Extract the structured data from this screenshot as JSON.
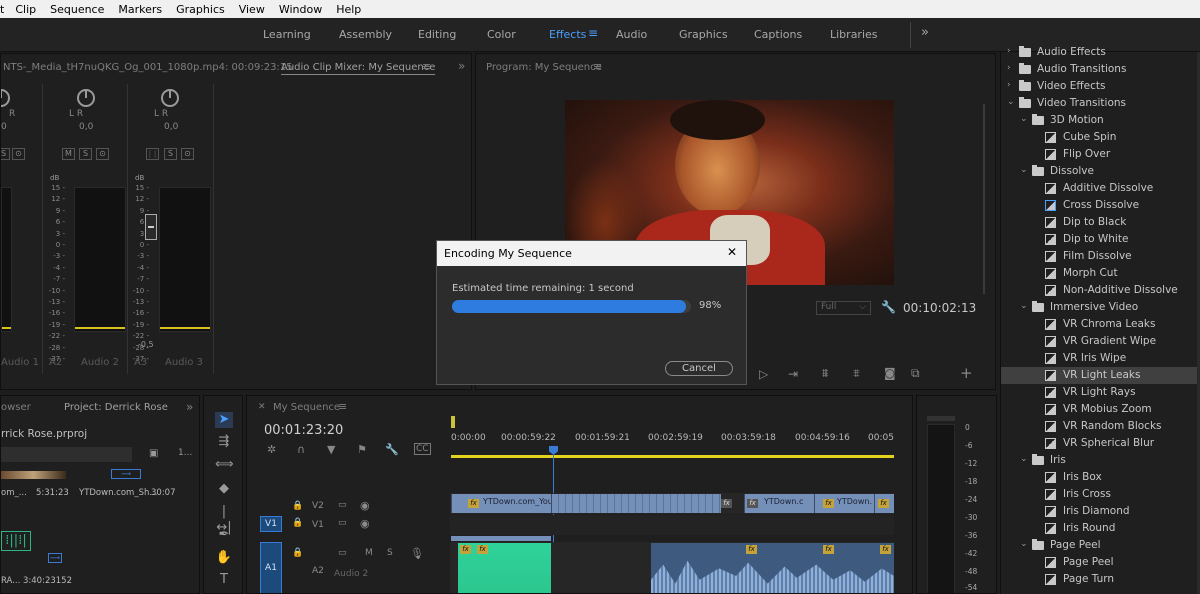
{
  "menu": [
    "t",
    "Clip",
    "Sequence",
    "Markers",
    "Graphics",
    "View",
    "Window",
    "Help"
  ],
  "workspaces": {
    "tabs": [
      "Learning",
      "Assembly",
      "Editing",
      "Color",
      "Effects",
      "Audio",
      "Graphics",
      "Captions",
      "Libraries"
    ],
    "active": "Effects",
    "overflow": "»"
  },
  "source_panel": {
    "clip_name": "NTS-_Media_tH7nuQKG_Og_001_1080p.mp4: 00:09:23:15",
    "tab": "Audio Clip Mixer: My Sequence",
    "channels": [
      {
        "lr": "L  R",
        "value": "0,0",
        "label": "Audio 1",
        "track": "A1"
      },
      {
        "lr": "L  R",
        "value": "0,0",
        "label": "Audio 2",
        "track": "A2"
      },
      {
        "lr": "L  R",
        "value": "0,0",
        "label": "Audio 3",
        "track": "A3"
      }
    ],
    "db_label": "dB",
    "db_scale": [
      "15 -",
      "12 -",
      "9 -",
      "6 -",
      "3 -",
      "0 -",
      "-3 -",
      "-4 -",
      "-7 -",
      "-10 -",
      "-13 -",
      "-16 -",
      "-19 -",
      "-22 -",
      "-28 -",
      "-37 -"
    ],
    "fader_value": "-0,5",
    "msr": [
      "M",
      "S",
      "R"
    ]
  },
  "program_monitor": {
    "title": "Program: My Sequence",
    "timecode": "00:10:02:13",
    "fit": "Full"
  },
  "dialog": {
    "title": "Encoding My Sequence",
    "status": "Estimated time remaining: 1 second",
    "progress": 98,
    "progress_text": "98%",
    "cancel": "Cancel",
    "close": "✕"
  },
  "project_panel": {
    "tabs": [
      "owser",
      "Project: Derrick Rose"
    ],
    "project_file": "rrick Rose.prproj",
    "page": "1...",
    "items": [
      {
        "name": "om_...",
        "duration": "5:31:23"
      },
      {
        "name": "YTDown.com_Sh...",
        "duration": "30:07"
      },
      {
        "name": "RA...",
        "duration": "3:40:23152"
      }
    ]
  },
  "timeline": {
    "tab": "My Sequence",
    "timecode": "00:01:23:20",
    "ruler": [
      "0:00:00",
      "00:00:59:22",
      "00:01:59:21",
      "00:02:59:19",
      "00:03:59:18",
      "00:04:59:16",
      "00:05"
    ],
    "tracks": [
      {
        "id": "V2",
        "patch": ""
      },
      {
        "id": "V1",
        "patch": "V1"
      },
      {
        "id": "A2",
        "patch": "A1",
        "name": "Audio 2"
      }
    ],
    "clips_v2": [
      "YTDown.com_You",
      "YTDown.c",
      "YTDown."
    ],
    "fx": "fx"
  },
  "audio_meter_scale": [
    "0",
    "-6",
    "-12",
    "-18",
    "-24",
    "-30",
    "-36",
    "-42",
    "-48",
    "-54"
  ],
  "effects_panel": {
    "rows": [
      {
        "level": 0,
        "type": "folder",
        "label": "Audio Effects",
        "expanded": false
      },
      {
        "level": 0,
        "type": "folder",
        "label": "Audio Transitions",
        "expanded": false
      },
      {
        "level": 0,
        "type": "folder",
        "label": "Video Effects",
        "expanded": false
      },
      {
        "level": 0,
        "type": "folder",
        "label": "Video Transitions",
        "expanded": true
      },
      {
        "level": 1,
        "type": "folder",
        "label": "3D Motion",
        "expanded": true
      },
      {
        "level": 2,
        "type": "fx",
        "label": "Cube Spin"
      },
      {
        "level": 2,
        "type": "fx",
        "label": "Flip Over"
      },
      {
        "level": 1,
        "type": "folder",
        "label": "Dissolve",
        "expanded": true
      },
      {
        "level": 2,
        "type": "fx",
        "label": "Additive Dissolve"
      },
      {
        "level": 2,
        "type": "fx",
        "label": "Cross Dissolve",
        "highlight": true
      },
      {
        "level": 2,
        "type": "fx",
        "label": "Dip to Black"
      },
      {
        "level": 2,
        "type": "fx",
        "label": "Dip to White"
      },
      {
        "level": 2,
        "type": "fx",
        "label": "Film Dissolve"
      },
      {
        "level": 2,
        "type": "fx",
        "label": "Morph Cut"
      },
      {
        "level": 2,
        "type": "fx",
        "label": "Non-Additive Dissolve"
      },
      {
        "level": 1,
        "type": "folder",
        "label": "Immersive Video",
        "expanded": true
      },
      {
        "level": 2,
        "type": "fx",
        "label": "VR Chroma Leaks"
      },
      {
        "level": 2,
        "type": "fx",
        "label": "VR Gradient Wipe"
      },
      {
        "level": 2,
        "type": "fx",
        "label": "VR Iris Wipe"
      },
      {
        "level": 2,
        "type": "fx",
        "label": "VR Light Leaks",
        "selected": true
      },
      {
        "level": 2,
        "type": "fx",
        "label": "VR Light Rays"
      },
      {
        "level": 2,
        "type": "fx",
        "label": "VR Mobius Zoom"
      },
      {
        "level": 2,
        "type": "fx",
        "label": "VR Random Blocks"
      },
      {
        "level": 2,
        "type": "fx",
        "label": "VR Spherical Blur"
      },
      {
        "level": 1,
        "type": "folder",
        "label": "Iris",
        "expanded": true
      },
      {
        "level": 2,
        "type": "fx",
        "label": "Iris Box"
      },
      {
        "level": 2,
        "type": "fx",
        "label": "Iris Cross"
      },
      {
        "level": 2,
        "type": "fx",
        "label": "Iris Diamond"
      },
      {
        "level": 2,
        "type": "fx",
        "label": "Iris Round"
      },
      {
        "level": 1,
        "type": "folder",
        "label": "Page Peel",
        "expanded": true
      },
      {
        "level": 2,
        "type": "fx",
        "label": "Page Peel"
      },
      {
        "level": 2,
        "type": "fx",
        "label": "Page Turn"
      }
    ]
  }
}
